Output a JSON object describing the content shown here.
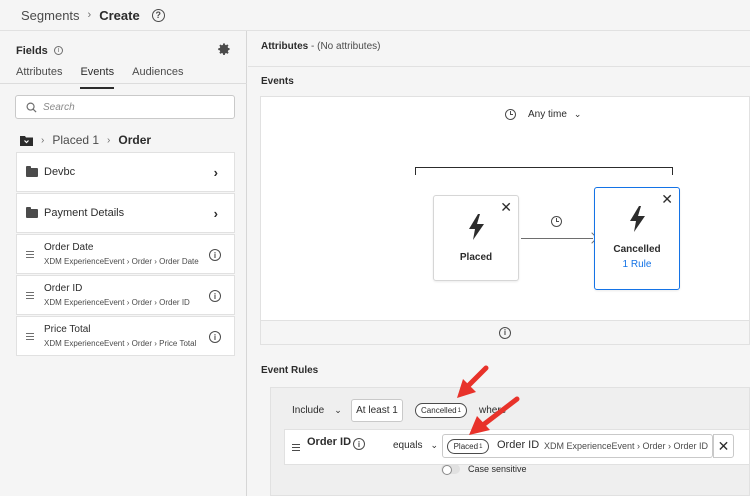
{
  "breadcrumb": {
    "parent": "Segments",
    "separator": "›",
    "current": "Create",
    "help_icon": "?"
  },
  "fields_panel": {
    "title": "Fields",
    "info_icon": "i",
    "tabs": [
      "Attributes",
      "Events",
      "Audiences"
    ],
    "active_tab": "Events",
    "search_placeholder": "Search",
    "path": {
      "root": "Placed 1",
      "separator": "›",
      "current": "Order"
    },
    "folders": [
      {
        "label": "Devbc"
      },
      {
        "label": "Payment Details"
      }
    ],
    "leaves": [
      {
        "title": "Order Date",
        "path": "XDM ExperienceEvent › Order › Order Date"
      },
      {
        "title": "Order ID",
        "path": "XDM ExperienceEvent › Order › Order ID"
      },
      {
        "title": "Price Total",
        "path": "XDM ExperienceEvent › Order › Price Total"
      }
    ]
  },
  "attributes": {
    "label": "Attributes",
    "value": " - (No attributes)"
  },
  "events": {
    "title": "Events",
    "time_constraint": "Any time",
    "cards": [
      {
        "title": "Placed"
      },
      {
        "title": "Cancelled",
        "rule_link": "1 Rule"
      }
    ]
  },
  "event_rules": {
    "title": "Event Rules",
    "include": "Include",
    "count_button": "At least 1",
    "event_pill": "Cancelled",
    "event_pill_sup": "1",
    "where": "where",
    "rule": {
      "field": "Order ID",
      "operator": "equals",
      "value_pill": "Placed",
      "value_pill_sup": "1",
      "value_label": "Order ID",
      "value_path": "XDM ExperienceEvent › Order › Order ID",
      "case_sensitive_label": "Case sensitive"
    }
  },
  "colors": {
    "accent_blue": "#1473e6",
    "annotation_red": "#e8322a"
  }
}
